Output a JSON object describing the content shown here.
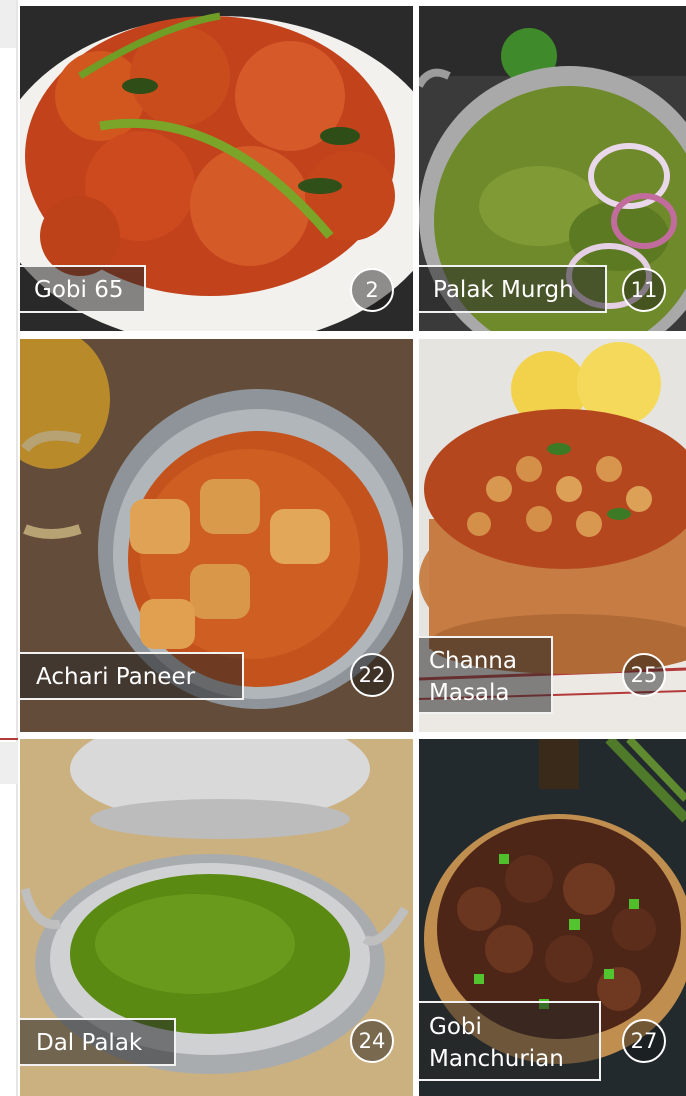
{
  "colors": {
    "overlay_border": "#f2f2f2",
    "accent_rule": "#b53a3a"
  },
  "tiles": [
    {
      "name": "Gobi 65",
      "count": "2"
    },
    {
      "name": "Palak Murgh",
      "count": "11"
    },
    {
      "name": "Achari Paneer",
      "count": "22"
    },
    {
      "name": "Channa\nMasala",
      "count": "25"
    },
    {
      "name": "Dal Palak",
      "count": "24"
    },
    {
      "name": "Gobi\nManchurian",
      "count": "27"
    }
  ]
}
